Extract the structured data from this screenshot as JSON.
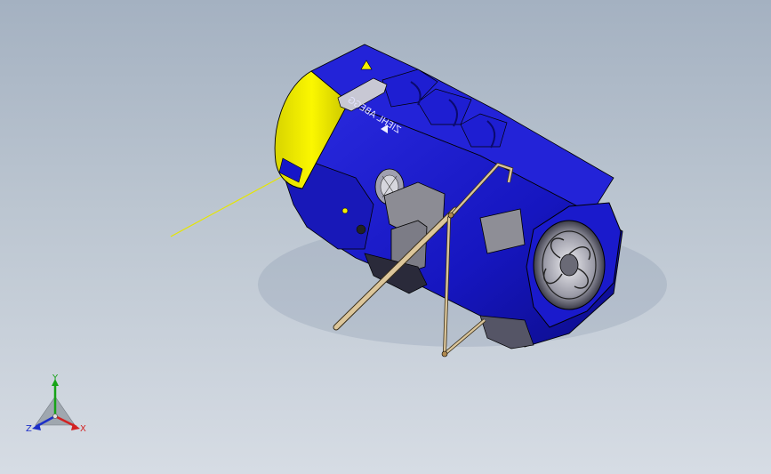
{
  "viewport": {
    "background_top": "#a4b1c1",
    "background_bottom": "#d6dce4"
  },
  "model": {
    "body_color": "#1616c8",
    "body_dark": "#0c0c8a",
    "cap_color": "#f4f000",
    "fan_color": "#c8c8d0",
    "rod_color": "#d9c49a",
    "engraved_text": "ZIEHL ABEGG"
  },
  "triad": {
    "x_label": "X",
    "y_label": "Y",
    "z_label": "Z",
    "x_color": "#d22222",
    "y_color": "#17a317",
    "z_color": "#1c2fc8"
  }
}
